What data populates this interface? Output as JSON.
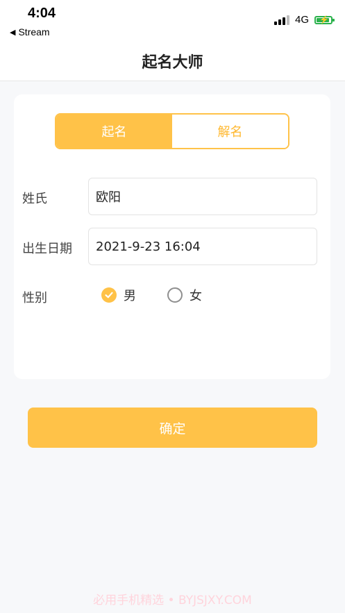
{
  "status_bar": {
    "time": "4:04",
    "back_label": "Stream",
    "network": "4G"
  },
  "nav": {
    "title": "起名大师"
  },
  "segments": {
    "naming": "起名",
    "interpret": "解名"
  },
  "form": {
    "surname_label": "姓氏",
    "surname_value": "欧阳",
    "birth_label": "出生日期",
    "birth_value": "2021-9-23 16:04",
    "gender_label": "性别",
    "gender_male": "男",
    "gender_female": "女",
    "gender_selected": "男"
  },
  "confirm_label": "确定",
  "watermark": "必用手机精选 • BYJSJXY.COM",
  "colors": {
    "accent": "#ffc248",
    "background": "#f7f8fa",
    "battery": "#2bb24c"
  },
  "icons": {
    "back": "back-triangle-icon",
    "signal": "cellular-signal-icon",
    "battery": "battery-charging-icon",
    "radio_checked": "check-circle-icon",
    "radio_unchecked": "radio-empty-icon"
  }
}
